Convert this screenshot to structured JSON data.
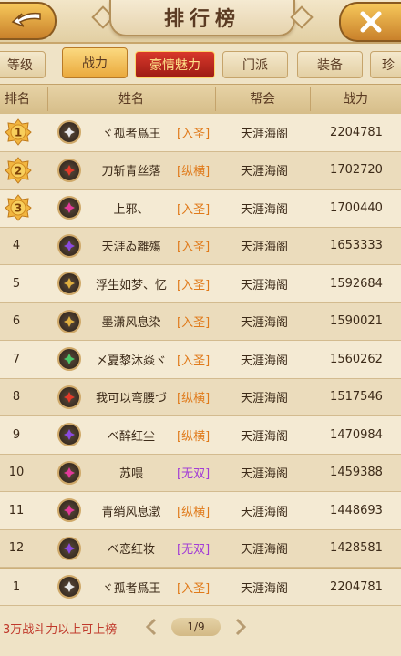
{
  "header": {
    "title": "排行榜"
  },
  "tabs": [
    {
      "label": "等级",
      "state": "normal"
    },
    {
      "label": "战力",
      "state": "active"
    },
    {
      "label": "豪情魅力",
      "state": "special"
    },
    {
      "label": "门派",
      "state": "normal"
    },
    {
      "label": "装备",
      "state": "normal"
    },
    {
      "label": "珍",
      "state": "normal"
    }
  ],
  "columns": {
    "rank": "排名",
    "name": "姓名",
    "guild": "帮会",
    "power": "战力"
  },
  "colors": {
    "tag_orange": "#e07a1a",
    "tag_purple": "#a23cd6",
    "hint_red": "#c0392b"
  },
  "rows": [
    {
      "rank": "1",
      "medal": "gold",
      "icon": "class-icon-white",
      "name": "ヾ孤者爲王",
      "tag": "[入圣]",
      "tag_color": "orange",
      "guild": "天涯海阁",
      "power": "2204781"
    },
    {
      "rank": "2",
      "medal": "gold",
      "icon": "class-icon-red",
      "name": "刀斩青丝落",
      "tag": "[纵横]",
      "tag_color": "orange",
      "guild": "天涯海阁",
      "power": "1702720"
    },
    {
      "rank": "3",
      "medal": "gold",
      "icon": "class-icon-pink",
      "name": "上邪、",
      "tag": "[入圣]",
      "tag_color": "orange",
      "guild": "天涯海阁",
      "power": "1700440"
    },
    {
      "rank": "4",
      "icon": "class-icon-purple",
      "name": "天涯ゐ離殤",
      "tag": "[入圣]",
      "tag_color": "orange",
      "guild": "天涯海阁",
      "power": "1653333"
    },
    {
      "rank": "5",
      "icon": "class-icon-gold",
      "name": "浮生如梦、忆",
      "tag": "[入圣]",
      "tag_color": "orange",
      "guild": "天涯海阁",
      "power": "1592684"
    },
    {
      "rank": "6",
      "icon": "class-icon-gold",
      "name": "墨潇风息染",
      "tag": "[入圣]",
      "tag_color": "orange",
      "guild": "天涯海阁",
      "power": "1590021"
    },
    {
      "rank": "7",
      "icon": "class-icon-green",
      "name": "〆夏黎沐焱ヾ",
      "tag": "[入圣]",
      "tag_color": "orange",
      "guild": "天涯海阁",
      "power": "1560262"
    },
    {
      "rank": "8",
      "icon": "class-icon-red",
      "name": "我可以弯腰づ",
      "tag": "[纵横]",
      "tag_color": "orange",
      "guild": "天涯海阁",
      "power": "1517546"
    },
    {
      "rank": "9",
      "icon": "class-icon-purple",
      "name": "べ醉红尘",
      "tag": "[纵横]",
      "tag_color": "orange",
      "guild": "天涯海阁",
      "power": "1470984"
    },
    {
      "rank": "10",
      "icon": "class-icon-pink",
      "name": "苏喂",
      "tag": "[无双]",
      "tag_color": "purple",
      "guild": "天涯海阁",
      "power": "1459388"
    },
    {
      "rank": "11",
      "icon": "class-icon-pink",
      "name": "青绡风息澂",
      "tag": "[纵横]",
      "tag_color": "orange",
      "guild": "天涯海阁",
      "power": "1448693"
    },
    {
      "rank": "12",
      "icon": "class-icon-purple",
      "name": "べ恋红妆",
      "tag": "[无双]",
      "tag_color": "purple",
      "guild": "天涯海阁",
      "power": "1428581"
    }
  ],
  "self_row": {
    "rank": "1",
    "icon": "class-icon-white",
    "name": "ヾ孤者爲王",
    "tag": "[入圣]",
    "tag_color": "orange",
    "guild": "天涯海阁",
    "power": "2204781"
  },
  "footer": {
    "hint": "3万战斗力以上可上榜",
    "page": "1/9"
  }
}
